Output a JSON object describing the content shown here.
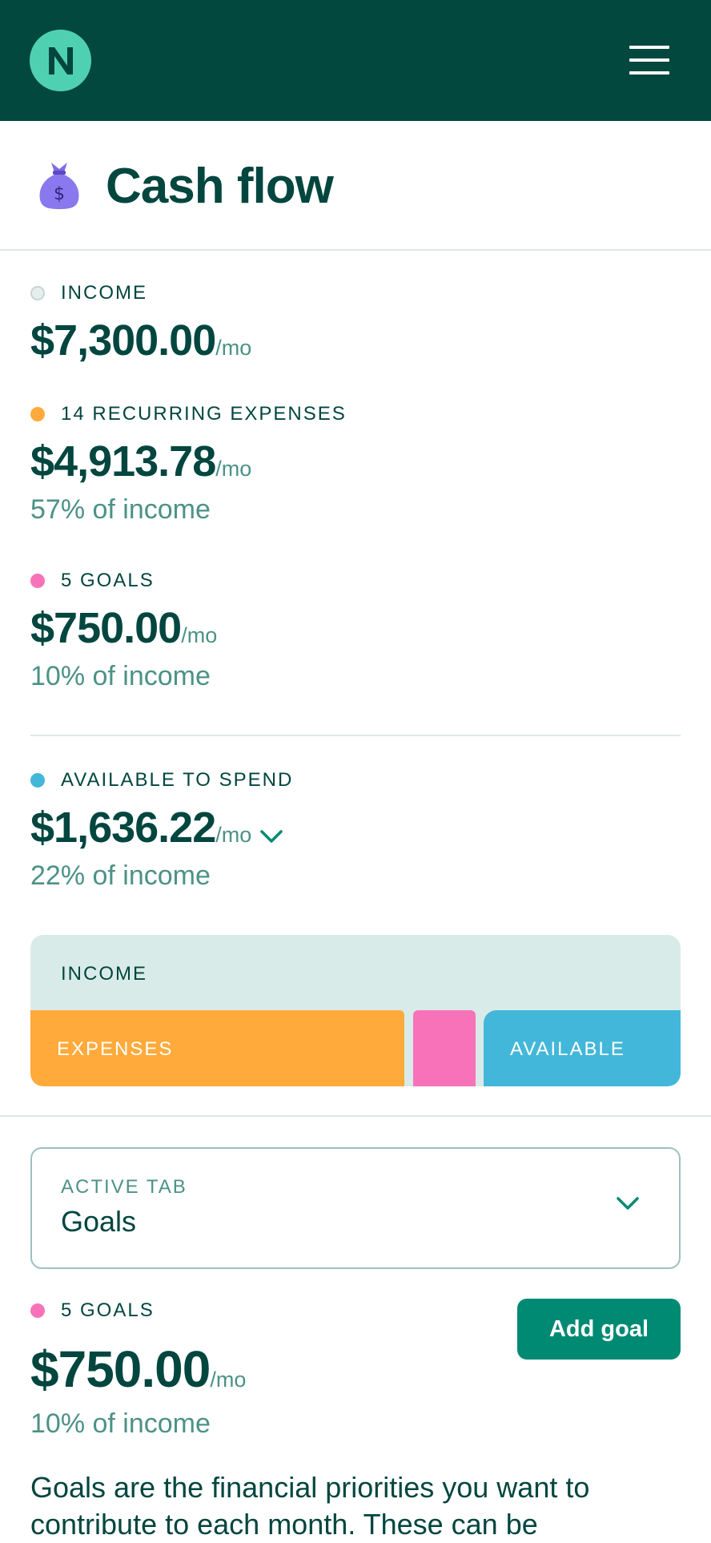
{
  "header": {
    "logo_letter": "N",
    "logo_icon": "brand-logo-icon",
    "menu_icon": "hamburger-menu-icon"
  },
  "page": {
    "icon": "money-bag-icon",
    "title": "Cash flow"
  },
  "summary": {
    "income": {
      "label": "INCOME",
      "amount": "$7,300.00",
      "per": "/mo",
      "dot_color": "#D5E4E1"
    },
    "expenses": {
      "label": "14 RECURRING EXPENSES",
      "amount": "$4,913.78",
      "per": "/mo",
      "pct": "57% of income",
      "dot_color": "#FFAA3B"
    },
    "goals": {
      "label": "5 GOALS",
      "amount": "$750.00",
      "per": "/mo",
      "pct": "10% of income",
      "dot_color": "#F872B9"
    },
    "available": {
      "label": "AVAILABLE TO SPEND",
      "amount": "$1,636.22",
      "per": "/mo",
      "pct": "22% of income",
      "dot_color": "#43B7D9",
      "expand_icon": "chevron-down-icon"
    }
  },
  "breakdown_bar": {
    "income_label": "INCOME",
    "income_color": "#D9EBE8",
    "segments": [
      {
        "name": "expenses",
        "label": "EXPENSES",
        "color": "#FFAA3B",
        "share": 0.57
      },
      {
        "name": "goals",
        "label": "",
        "color": "#F872B9",
        "share": 0.1
      },
      {
        "name": "available",
        "label": "AVAILABLE",
        "color": "#43B7D9",
        "share": 0.22
      }
    ]
  },
  "tab_select": {
    "caption": "ACTIVE TAB",
    "value": "Goals",
    "icon": "chevron-down-icon"
  },
  "goals_section": {
    "label": "5 GOALS",
    "amount": "$750.00",
    "per": "/mo",
    "pct": "10% of income",
    "add_button": "Add goal",
    "description": "Goals are the financial priorities you want to contribute to each month. These can be"
  },
  "colors": {
    "header_bg": "#02483F",
    "brand_accent": "#4FD1B1",
    "text_dark": "#02463F",
    "text_muted": "#4C9286",
    "button_primary": "#018A73"
  }
}
